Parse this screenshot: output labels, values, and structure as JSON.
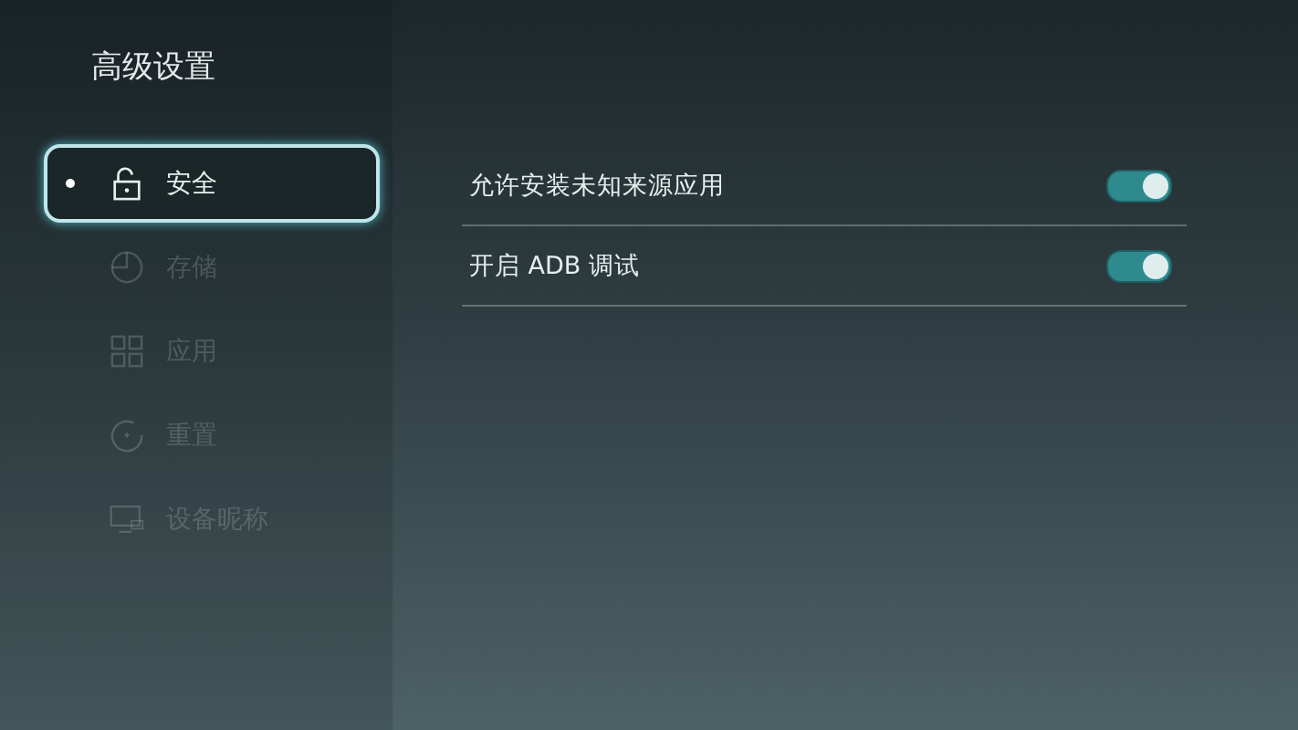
{
  "title": "高级设置",
  "sidebar": {
    "items": [
      {
        "label": "安全",
        "kind": "lock",
        "selected": true
      },
      {
        "label": "存储",
        "kind": "pie",
        "selected": false
      },
      {
        "label": "应用",
        "kind": "grid",
        "selected": false
      },
      {
        "label": "重置",
        "kind": "reset",
        "selected": false
      },
      {
        "label": "设备昵称",
        "kind": "monitor",
        "selected": false
      }
    ]
  },
  "settings": [
    {
      "label": "允许安装未知来源应用",
      "on": true
    },
    {
      "label": "开启 ADB 调试",
      "on": true
    }
  ]
}
